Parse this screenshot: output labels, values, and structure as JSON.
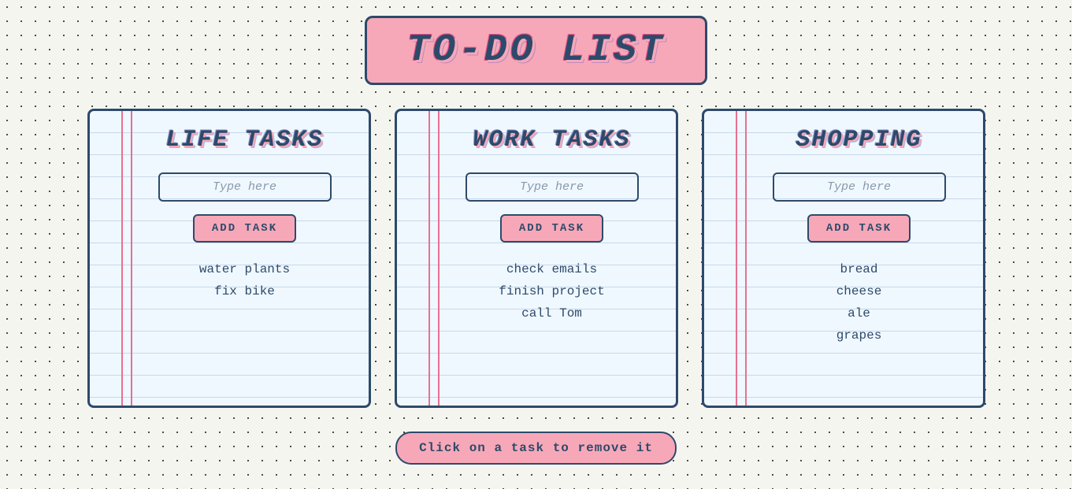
{
  "app": {
    "title": "TO-DO LIST"
  },
  "columns": [
    {
      "id": "life",
      "heading": "LIFE TASKS",
      "input_placeholder": "Type here",
      "add_button_label": "ADD TASK",
      "tasks": [
        "water plants",
        "fix bike"
      ]
    },
    {
      "id": "work",
      "heading": "WORK TASKS",
      "input_placeholder": "Type here",
      "add_button_label": "ADD TASK",
      "tasks": [
        "check emails",
        "finish project",
        "call Tom"
      ]
    },
    {
      "id": "shopping",
      "heading": "SHOPPING",
      "input_placeholder": "Type here",
      "add_button_label": "ADD TASK",
      "tasks": [
        "bread",
        "cheese",
        "ale",
        "grapes"
      ]
    }
  ],
  "hint": {
    "text": "Click on a task to remove it"
  },
  "colors": {
    "accent": "#f7a8b8",
    "dark": "#2d4a6b"
  }
}
